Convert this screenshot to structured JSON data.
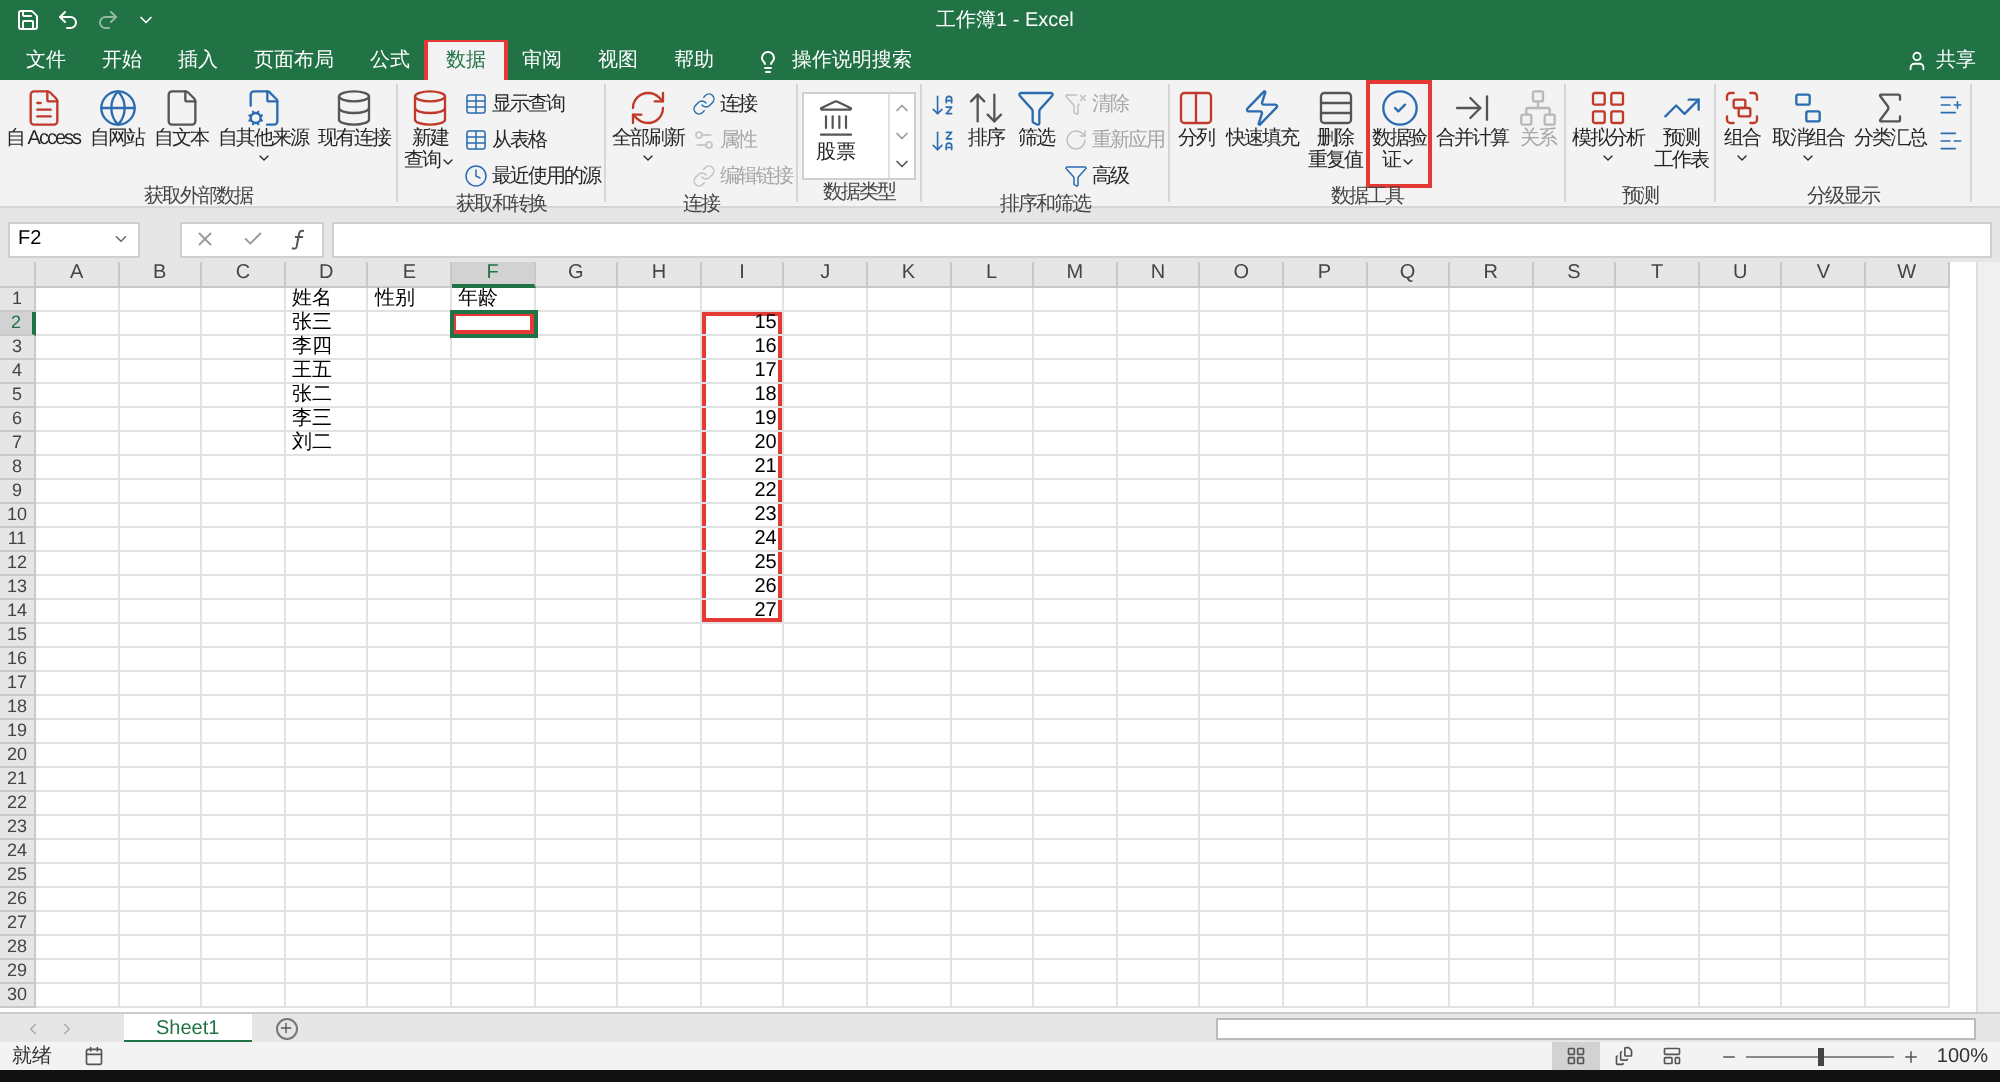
{
  "window": {
    "title": "工作簿1 - Excel"
  },
  "tabs": [
    {
      "label": "文件",
      "selected": false,
      "highlighted": false
    },
    {
      "label": "开始",
      "selected": false,
      "highlighted": false
    },
    {
      "label": "插入",
      "selected": false,
      "highlighted": false
    },
    {
      "label": "页面布局",
      "selected": false,
      "highlighted": false
    },
    {
      "label": "公式",
      "selected": false,
      "highlighted": false
    },
    {
      "label": "数据",
      "selected": true,
      "highlighted": true
    },
    {
      "label": "审阅",
      "selected": false,
      "highlighted": false
    },
    {
      "label": "视图",
      "selected": false,
      "highlighted": false
    },
    {
      "label": "帮助",
      "selected": false,
      "highlighted": false
    }
  ],
  "tell_me": "操作说明搜索",
  "share": "共享",
  "ribbon_groups": [
    {
      "name": "获取外部数据",
      "items": [
        {
          "kind": "large",
          "lines": [
            "自 Access"
          ],
          "dropdown": false,
          "disabled": false,
          "highlighted": false
        },
        {
          "kind": "large",
          "lines": [
            "自网站"
          ],
          "dropdown": false,
          "disabled": false,
          "highlighted": false
        },
        {
          "kind": "large",
          "lines": [
            "自文本"
          ],
          "dropdown": false,
          "disabled": false,
          "highlighted": false
        },
        {
          "kind": "large",
          "lines": [
            "自其他来源"
          ],
          "dropdown": true,
          "disabled": false,
          "highlighted": false
        },
        {
          "kind": "large",
          "lines": [
            "现有连接"
          ],
          "dropdown": false,
          "disabled": false,
          "highlighted": false
        }
      ]
    },
    {
      "name": "获取和转换",
      "items": [
        {
          "kind": "large",
          "lines": [
            "新建",
            "查询"
          ],
          "dropdown": true,
          "disabled": false,
          "highlighted": false
        },
        {
          "kind": "small",
          "label": "显示查询",
          "disabled": false
        },
        {
          "kind": "small",
          "label": "从表格",
          "disabled": false
        },
        {
          "kind": "small",
          "label": "最近使用的源",
          "disabled": false
        }
      ]
    },
    {
      "name": "连接",
      "items": [
        {
          "kind": "large",
          "lines": [
            "全部刷新"
          ],
          "dropdown": true,
          "disabled": false,
          "highlighted": false
        },
        {
          "kind": "small",
          "label": "连接",
          "disabled": false
        },
        {
          "kind": "small",
          "label": "属性",
          "disabled": true
        },
        {
          "kind": "small",
          "label": "编辑链接",
          "disabled": true
        }
      ]
    },
    {
      "name": "数据类型",
      "items": [
        {
          "kind": "gallery",
          "label": "股票"
        }
      ]
    },
    {
      "name": "排序和筛选",
      "items": [
        {
          "kind": "icon"
        },
        {
          "kind": "icon"
        },
        {
          "kind": "large",
          "lines": [
            "排序"
          ],
          "dropdown": false,
          "disabled": false,
          "highlighted": false
        },
        {
          "kind": "large",
          "lines": [
            "筛选"
          ],
          "dropdown": false,
          "disabled": false,
          "highlighted": false
        },
        {
          "kind": "small",
          "label": "清除",
          "disabled": true
        },
        {
          "kind": "small",
          "label": "重新应用",
          "disabled": true
        },
        {
          "kind": "small",
          "label": "高级",
          "disabled": false
        }
      ]
    },
    {
      "name": "数据工具",
      "items": [
        {
          "kind": "large",
          "lines": [
            "分列"
          ],
          "dropdown": false,
          "disabled": false,
          "highlighted": false
        },
        {
          "kind": "large",
          "lines": [
            "快速填充"
          ],
          "dropdown": false,
          "disabled": false,
          "highlighted": false
        },
        {
          "kind": "large",
          "lines": [
            "删除",
            "重复值"
          ],
          "dropdown": false,
          "disabled": false,
          "highlighted": false
        },
        {
          "kind": "large",
          "lines": [
            "数据验",
            "证"
          ],
          "dropdown": true,
          "disabled": false,
          "highlighted": true
        },
        {
          "kind": "large",
          "lines": [
            "合并计算"
          ],
          "dropdown": false,
          "disabled": false,
          "highlighted": false
        },
        {
          "kind": "large",
          "lines": [
            "关系"
          ],
          "dropdown": false,
          "disabled": true,
          "highlighted": false
        }
      ]
    },
    {
      "name": "预测",
      "items": [
        {
          "kind": "large",
          "lines": [
            "模拟分析"
          ],
          "dropdown": true,
          "disabled": false,
          "highlighted": false
        },
        {
          "kind": "large",
          "lines": [
            "预测",
            "工作表"
          ],
          "dropdown": false,
          "disabled": false,
          "highlighted": false
        }
      ]
    },
    {
      "name": "分级显示",
      "items": [
        {
          "kind": "large",
          "lines": [
            "组合"
          ],
          "dropdown": true,
          "disabled": false,
          "highlighted": false
        },
        {
          "kind": "large",
          "lines": [
            "取消组合"
          ],
          "dropdown": true,
          "disabled": false,
          "highlighted": false
        },
        {
          "kind": "large",
          "lines": [
            "分类汇总"
          ],
          "dropdown": false,
          "disabled": false,
          "highlighted": false
        },
        {
          "kind": "icon"
        },
        {
          "kind": "icon"
        }
      ]
    }
  ],
  "name_box": "F2",
  "columns": [
    {
      "label": "A",
      "selected": false
    },
    {
      "label": "B",
      "selected": false
    },
    {
      "label": "C",
      "selected": false
    },
    {
      "label": "D",
      "selected": false
    },
    {
      "label": "E",
      "selected": false
    },
    {
      "label": "F",
      "selected": true
    },
    {
      "label": "G",
      "selected": false
    },
    {
      "label": "H",
      "selected": false
    },
    {
      "label": "I",
      "selected": false
    },
    {
      "label": "J",
      "selected": false
    },
    {
      "label": "K",
      "selected": false
    },
    {
      "label": "L",
      "selected": false
    },
    {
      "label": "M",
      "selected": false
    },
    {
      "label": "N",
      "selected": false
    },
    {
      "label": "O",
      "selected": false
    },
    {
      "label": "P",
      "selected": false
    },
    {
      "label": "Q",
      "selected": false
    },
    {
      "label": "R",
      "selected": false
    },
    {
      "label": "S",
      "selected": false
    },
    {
      "label": "T",
      "selected": false
    },
    {
      "label": "U",
      "selected": false
    },
    {
      "label": "V",
      "selected": false
    },
    {
      "label": "W",
      "selected": false
    }
  ],
  "rows": [
    {
      "label": "1",
      "selected": false,
      "cells": [
        {
          "kind": "empty",
          "outlined": false
        },
        {
          "kind": "empty",
          "outlined": false
        },
        {
          "kind": "empty",
          "outlined": false
        },
        {
          "kind": "text",
          "value": "姓名",
          "outlined": false
        },
        {
          "kind": "text",
          "value": "性别",
          "outlined": false
        },
        {
          "kind": "text",
          "value": "年龄",
          "outlined": false
        }
      ]
    },
    {
      "label": "2",
      "selected": true,
      "cells": [
        {
          "kind": "empty",
          "outlined": false
        },
        {
          "kind": "empty",
          "outlined": false
        },
        {
          "kind": "empty",
          "outlined": false
        },
        {
          "kind": "text",
          "value": "张三",
          "outlined": false
        },
        {
          "kind": "empty",
          "outlined": false
        },
        {
          "kind": "empty",
          "outlined": true
        },
        {
          "kind": "empty",
          "outlined": false
        },
        {
          "kind": "empty",
          "outlined": false
        },
        {
          "kind": "number",
          "value": "15",
          "outlined": true
        }
      ]
    },
    {
      "label": "3",
      "selected": false,
      "cells": [
        {
          "kind": "empty",
          "outlined": false
        },
        {
          "kind": "empty",
          "outlined": false
        },
        {
          "kind": "empty",
          "outlined": false
        },
        {
          "kind": "text",
          "value": "李四",
          "outlined": false
        },
        {
          "kind": "empty",
          "outlined": false
        },
        {
          "kind": "empty",
          "outlined": false
        },
        {
          "kind": "empty",
          "outlined": false
        },
        {
          "kind": "empty",
          "outlined": false
        },
        {
          "kind": "number",
          "value": "16",
          "outlined": true
        }
      ]
    },
    {
      "label": "4",
      "selected": false,
      "cells": [
        {
          "kind": "empty",
          "outlined": false
        },
        {
          "kind": "empty",
          "outlined": false
        },
        {
          "kind": "empty",
          "outlined": false
        },
        {
          "kind": "text",
          "value": "王五",
          "outlined": false
        },
        {
          "kind": "empty",
          "outlined": false
        },
        {
          "kind": "empty",
          "outlined": false
        },
        {
          "kind": "empty",
          "outlined": false
        },
        {
          "kind": "empty",
          "outlined": false
        },
        {
          "kind": "number",
          "value": "17",
          "outlined": true
        }
      ]
    },
    {
      "label": "5",
      "selected": false,
      "cells": [
        {
          "kind": "empty",
          "outlined": false
        },
        {
          "kind": "empty",
          "outlined": false
        },
        {
          "kind": "empty",
          "outlined": false
        },
        {
          "kind": "text",
          "value": "张二",
          "outlined": false
        },
        {
          "kind": "empty",
          "outlined": false
        },
        {
          "kind": "empty",
          "outlined": false
        },
        {
          "kind": "empty",
          "outlined": false
        },
        {
          "kind": "empty",
          "outlined": false
        },
        {
          "kind": "number",
          "value": "18",
          "outlined": true
        }
      ]
    },
    {
      "label": "6",
      "selected": false,
      "cells": [
        {
          "kind": "empty",
          "outlined": false
        },
        {
          "kind": "empty",
          "outlined": false
        },
        {
          "kind": "empty",
          "outlined": false
        },
        {
          "kind": "text",
          "value": "李三",
          "outlined": false
        },
        {
          "kind": "empty",
          "outlined": false
        },
        {
          "kind": "empty",
          "outlined": false
        },
        {
          "kind": "empty",
          "outlined": false
        },
        {
          "kind": "empty",
          "outlined": false
        },
        {
          "kind": "number",
          "value": "19",
          "outlined": true
        }
      ]
    },
    {
      "label": "7",
      "selected": false,
      "cells": [
        {
          "kind": "empty",
          "outlined": false
        },
        {
          "kind": "empty",
          "outlined": false
        },
        {
          "kind": "empty",
          "outlined": false
        },
        {
          "kind": "text",
          "value": "刘二",
          "outlined": false
        },
        {
          "kind": "empty",
          "outlined": false
        },
        {
          "kind": "empty",
          "outlined": false
        },
        {
          "kind": "empty",
          "outlined": false
        },
        {
          "kind": "empty",
          "outlined": false
        },
        {
          "kind": "number",
          "value": "20",
          "outlined": true
        }
      ]
    },
    {
      "label": "8",
      "selected": false,
      "cells": [
        {
          "kind": "empty",
          "outlined": false
        },
        {
          "kind": "empty",
          "outlined": false
        },
        {
          "kind": "empty",
          "outlined": false
        },
        {
          "kind": "empty",
          "outlined": false
        },
        {
          "kind": "empty",
          "outlined": false
        },
        {
          "kind": "empty",
          "outlined": false
        },
        {
          "kind": "empty",
          "outlined": false
        },
        {
          "kind": "empty",
          "outlined": false
        },
        {
          "kind": "number",
          "value": "21",
          "outlined": true
        }
      ]
    },
    {
      "label": "9",
      "selected": false,
      "cells": [
        {
          "kind": "empty",
          "outlined": false
        },
        {
          "kind": "empty",
          "outlined": false
        },
        {
          "kind": "empty",
          "outlined": false
        },
        {
          "kind": "empty",
          "outlined": false
        },
        {
          "kind": "empty",
          "outlined": false
        },
        {
          "kind": "empty",
          "outlined": false
        },
        {
          "kind": "empty",
          "outlined": false
        },
        {
          "kind": "empty",
          "outlined": false
        },
        {
          "kind": "number",
          "value": "22",
          "outlined": true
        }
      ]
    },
    {
      "label": "10",
      "selected": false,
      "cells": [
        {
          "kind": "empty",
          "outlined": false
        },
        {
          "kind": "empty",
          "outlined": false
        },
        {
          "kind": "empty",
          "outlined": false
        },
        {
          "kind": "empty",
          "outlined": false
        },
        {
          "kind": "empty",
          "outlined": false
        },
        {
          "kind": "empty",
          "outlined": false
        },
        {
          "kind": "empty",
          "outlined": false
        },
        {
          "kind": "empty",
          "outlined": false
        },
        {
          "kind": "number",
          "value": "23",
          "outlined": true
        }
      ]
    },
    {
      "label": "11",
      "selected": false,
      "cells": [
        {
          "kind": "empty",
          "outlined": false
        },
        {
          "kind": "empty",
          "outlined": false
        },
        {
          "kind": "empty",
          "outlined": false
        },
        {
          "kind": "empty",
          "outlined": false
        },
        {
          "kind": "empty",
          "outlined": false
        },
        {
          "kind": "empty",
          "outlined": false
        },
        {
          "kind": "empty",
          "outlined": false
        },
        {
          "kind": "empty",
          "outlined": false
        },
        {
          "kind": "number",
          "value": "24",
          "outlined": true
        }
      ]
    },
    {
      "label": "12",
      "selected": false,
      "cells": [
        {
          "kind": "empty",
          "outlined": false
        },
        {
          "kind": "empty",
          "outlined": false
        },
        {
          "kind": "empty",
          "outlined": false
        },
        {
          "kind": "empty",
          "outlined": false
        },
        {
          "kind": "empty",
          "outlined": false
        },
        {
          "kind": "empty",
          "outlined": false
        },
        {
          "kind": "empty",
          "outlined": false
        },
        {
          "kind": "empty",
          "outlined": false
        },
        {
          "kind": "number",
          "value": "25",
          "outlined": true
        }
      ]
    },
    {
      "label": "13",
      "selected": false,
      "cells": [
        {
          "kind": "empty",
          "outlined": false
        },
        {
          "kind": "empty",
          "outlined": false
        },
        {
          "kind": "empty",
          "outlined": false
        },
        {
          "kind": "empty",
          "outlined": false
        },
        {
          "kind": "empty",
          "outlined": false
        },
        {
          "kind": "empty",
          "outlined": false
        },
        {
          "kind": "empty",
          "outlined": false
        },
        {
          "kind": "empty",
          "outlined": false
        },
        {
          "kind": "number",
          "value": "26",
          "outlined": true
        }
      ]
    },
    {
      "label": "14",
      "selected": false,
      "cells": [
        {
          "kind": "empty",
          "outlined": false
        },
        {
          "kind": "empty",
          "outlined": false
        },
        {
          "kind": "empty",
          "outlined": false
        },
        {
          "kind": "empty",
          "outlined": false
        },
        {
          "kind": "empty",
          "outlined": false
        },
        {
          "kind": "empty",
          "outlined": false
        },
        {
          "kind": "empty",
          "outlined": false
        },
        {
          "kind": "empty",
          "outlined": false
        },
        {
          "kind": "number",
          "value": "27",
          "outlined": true
        }
      ]
    },
    {
      "label": "15",
      "selected": false
    },
    {
      "label": "16",
      "selected": false
    },
    {
      "label": "17",
      "selected": false
    },
    {
      "label": "18",
      "selected": false
    },
    {
      "label": "19",
      "selected": false
    },
    {
      "label": "20",
      "selected": false
    },
    {
      "label": "21",
      "selected": false
    },
    {
      "label": "22",
      "selected": false
    },
    {
      "label": "23",
      "selected": false
    },
    {
      "label": "24",
      "selected": false
    },
    {
      "label": "25",
      "selected": false
    },
    {
      "label": "26",
      "selected": false
    },
    {
      "label": "27",
      "selected": false
    },
    {
      "label": "28",
      "selected": false
    },
    {
      "label": "29",
      "selected": false
    },
    {
      "label": "30",
      "selected": false
    }
  ],
  "sheets": [
    {
      "label": "Sheet1",
      "selected": true
    }
  ],
  "status_bar": {
    "text": "就绪",
    "views": [
      {
        "selected": true
      },
      {
        "selected": false
      },
      {
        "selected": false
      }
    ],
    "zoom": {
      "level": 0.5
    },
    "zoom_text": "100%"
  }
}
